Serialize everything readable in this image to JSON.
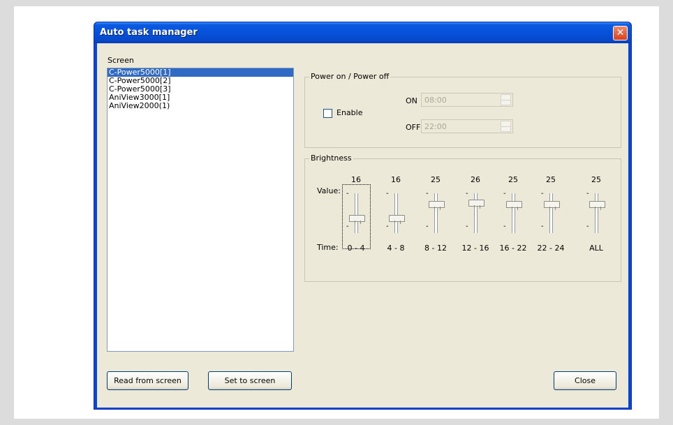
{
  "window": {
    "title": "Auto task manager"
  },
  "screen": {
    "label": "Screen",
    "items": [
      "C-Power5000[1]",
      "C-Power5000[2]",
      "C-Power5000[3]",
      "AniView3000[1]",
      "AniView2000(1)"
    ],
    "selected_index": 0
  },
  "power": {
    "caption": "Power on / Power off",
    "enable_label": "Enable",
    "enable_checked": false,
    "on_label": "ON",
    "on_value": "08:00",
    "off_label": "OFF",
    "off_value": "22:00"
  },
  "brightness": {
    "caption": "Brightness",
    "value_label": "Value:",
    "time_label": "Time:",
    "sliders": [
      {
        "value": "16",
        "time": "0 - 4"
      },
      {
        "value": "16",
        "time": "4 - 8"
      },
      {
        "value": "25",
        "time": "8 - 12"
      },
      {
        "value": "26",
        "time": "12 - 16"
      },
      {
        "value": "25",
        "time": "16 - 22"
      },
      {
        "value": "25",
        "time": "22 - 24"
      },
      {
        "value": "25",
        "time": "ALL"
      }
    ]
  },
  "buttons": {
    "read": "Read from screen",
    "set": "Set to screen",
    "close": "Close"
  }
}
